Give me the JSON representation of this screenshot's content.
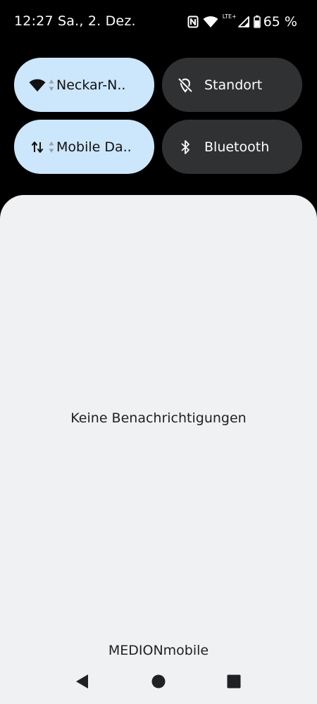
{
  "status_bar": {
    "time": "12:27",
    "date": "Sa., 2. Dez.",
    "network_type": "LTE+",
    "battery_percent": "65 %",
    "icons": [
      "nfc-icon",
      "wifi-icon",
      "cellular-signal-icon",
      "battery-icon"
    ]
  },
  "quick_settings": {
    "tiles": [
      {
        "label": "Neckar-N..",
        "icon": "wifi-icon",
        "active": true
      },
      {
        "label": "Standort",
        "icon": "location-off-icon",
        "active": false
      },
      {
        "label": "Mobile Da..",
        "icon": "mobile-data-icon",
        "active": true
      },
      {
        "label": "Bluetooth",
        "icon": "bluetooth-icon",
        "active": false
      }
    ]
  },
  "notifications": {
    "empty_message": "Keine Benachrichtigungen"
  },
  "footer": {
    "carrier": "MEDIONmobile"
  },
  "nav": {
    "icons": [
      "back-icon",
      "home-icon",
      "recents-icon"
    ]
  },
  "colors": {
    "tile_active": "#cce6fb",
    "tile_inactive": "#2f3133",
    "sheet_background": "#f0f1f3",
    "background": "#000000"
  }
}
